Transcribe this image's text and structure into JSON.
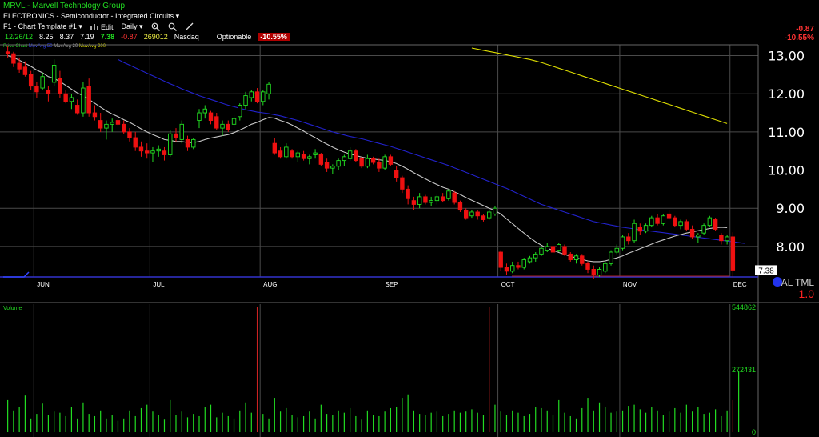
{
  "header": {
    "title": "MRVL - Marvell Technology Group",
    "sector": "ELECTRONICS - Semiconductor - Integrated Circuits",
    "sector_caret": "▾"
  },
  "toolbar": {
    "template": "F1 - Chart Template #1",
    "template_caret": "▾",
    "edit_label": "Edit",
    "period_label": "Daily",
    "period_caret": "▾"
  },
  "quote": {
    "date": "12/26/12",
    "open": "8.25",
    "high": "8.37",
    "low": "7.19",
    "close": "7.38",
    "change": "-0.87",
    "volume": "269012",
    "exchange": "Nasdaq",
    "options": "Optionable",
    "change_pct": "-10.55%"
  },
  "right_change": {
    "abs": "-0.87",
    "pct": "-10.55%"
  },
  "legend": {
    "price": "Price Chart",
    "ma50": "MovAvg 50",
    "ma20": "MovAvg 20",
    "ma200": "MovAvg 200"
  },
  "colors": {
    "up": "#22dd22",
    "down": "#ee1111",
    "ma20": "#c8c8c8",
    "ma50": "#2222cc",
    "ma200": "#dddd00",
    "grid": "#4a4a4a",
    "volume": "#22dd22"
  },
  "last_price_tag": "7.38",
  "axis_right_label": "AL TML",
  "axis_right_value": "1.0",
  "volume_label": "Volume",
  "chart_data": [
    {
      "type": "candlestick",
      "ylim": [
        7.2,
        13.2
      ],
      "yticks": [
        "13.00",
        "12.00",
        "11.00",
        "10.00",
        "9.00",
        "8.00"
      ],
      "months": [
        "JUN",
        "JUL",
        "AUG",
        "SEP",
        "OCT",
        "NOV",
        "DEC"
      ],
      "month_starts": [
        5,
        25,
        44,
        65,
        85,
        106,
        125
      ],
      "ohlc": [
        [
          13.1,
          13.25,
          12.95,
          13.05
        ],
        [
          13.05,
          13.1,
          12.7,
          12.8
        ],
        [
          12.8,
          12.95,
          12.55,
          12.65
        ],
        [
          12.7,
          12.85,
          12.45,
          12.5
        ],
        [
          12.5,
          12.6,
          12.1,
          12.2
        ],
        [
          12.2,
          12.3,
          11.9,
          12.05
        ],
        [
          12.15,
          12.55,
          12.1,
          12.45
        ],
        [
          12.1,
          12.2,
          11.8,
          12.0
        ],
        [
          12.3,
          12.9,
          12.2,
          12.75
        ],
        [
          12.4,
          12.6,
          11.9,
          12.0
        ],
        [
          12.0,
          12.1,
          11.75,
          11.8
        ],
        [
          11.8,
          12.0,
          11.6,
          11.9
        ],
        [
          11.7,
          11.85,
          11.45,
          11.5
        ],
        [
          11.5,
          12.3,
          11.4,
          12.15
        ],
        [
          12.2,
          12.4,
          11.4,
          11.5
        ],
        [
          11.5,
          11.7,
          11.3,
          11.4
        ],
        [
          11.3,
          11.5,
          11.0,
          11.1
        ],
        [
          11.1,
          11.3,
          10.8,
          11.2
        ],
        [
          11.2,
          11.35,
          11.0,
          11.25
        ],
        [
          11.3,
          11.4,
          11.15,
          11.2
        ],
        [
          11.2,
          11.3,
          10.95,
          11.0
        ],
        [
          11.0,
          11.1,
          10.75,
          10.85
        ],
        [
          10.85,
          11.0,
          10.5,
          10.6
        ],
        [
          10.6,
          10.75,
          10.35,
          10.5
        ],
        [
          10.5,
          10.7,
          10.3,
          10.45
        ],
        [
          10.45,
          10.6,
          10.2,
          10.5
        ],
        [
          10.5,
          10.65,
          10.35,
          10.55
        ],
        [
          10.5,
          10.6,
          10.25,
          10.4
        ],
        [
          10.4,
          11.05,
          10.35,
          10.95
        ],
        [
          10.95,
          11.1,
          10.75,
          10.85
        ],
        [
          10.8,
          11.3,
          10.7,
          11.2
        ],
        [
          10.8,
          10.9,
          10.5,
          10.6
        ],
        [
          10.6,
          10.85,
          10.55,
          10.8
        ],
        [
          11.3,
          11.6,
          11.1,
          11.5
        ],
        [
          11.5,
          11.7,
          11.35,
          11.6
        ],
        [
          11.5,
          11.55,
          11.2,
          11.3
        ],
        [
          11.4,
          11.5,
          11.05,
          11.1
        ],
        [
          11.1,
          11.3,
          10.9,
          11.2
        ],
        [
          11.2,
          11.3,
          11.0,
          11.05
        ],
        [
          11.2,
          11.45,
          11.1,
          11.35
        ],
        [
          11.4,
          11.75,
          11.3,
          11.7
        ],
        [
          11.7,
          12.05,
          11.6,
          11.95
        ],
        [
          11.9,
          12.1,
          11.8,
          12.05
        ],
        [
          12.05,
          12.15,
          11.75,
          11.8
        ],
        [
          11.8,
          12.1,
          11.7,
          12.05
        ],
        [
          12.0,
          12.3,
          11.85,
          12.25
        ],
        [
          10.7,
          10.85,
          10.4,
          10.45
        ],
        [
          10.5,
          10.6,
          10.3,
          10.35
        ],
        [
          10.35,
          10.7,
          10.3,
          10.6
        ],
        [
          10.5,
          10.55,
          10.3,
          10.35
        ],
        [
          10.35,
          10.5,
          10.2,
          10.45
        ],
        [
          10.4,
          10.5,
          10.25,
          10.3
        ],
        [
          10.3,
          10.4,
          10.15,
          10.35
        ],
        [
          10.4,
          10.55,
          10.3,
          10.45
        ],
        [
          10.4,
          10.45,
          10.1,
          10.15
        ],
        [
          10.2,
          10.3,
          9.95,
          10.05
        ],
        [
          10.05,
          10.15,
          9.9,
          10.1
        ],
        [
          10.1,
          10.3,
          10.0,
          10.25
        ],
        [
          10.25,
          10.4,
          10.1,
          10.35
        ],
        [
          10.3,
          10.6,
          10.25,
          10.5
        ],
        [
          10.5,
          10.55,
          10.2,
          10.25
        ],
        [
          10.3,
          10.35,
          10.05,
          10.1
        ],
        [
          10.1,
          10.4,
          10.05,
          10.3
        ],
        [
          10.3,
          10.35,
          10.15,
          10.2
        ],
        [
          10.2,
          10.3,
          9.95,
          10.05
        ],
        [
          10.05,
          10.4,
          10.0,
          10.35
        ],
        [
          10.35,
          10.4,
          10.1,
          10.15
        ],
        [
          10.0,
          10.1,
          9.7,
          9.8
        ],
        [
          9.8,
          9.85,
          9.4,
          9.5
        ],
        [
          9.5,
          9.6,
          9.1,
          9.25
        ],
        [
          9.2,
          9.3,
          8.95,
          9.1
        ],
        [
          9.1,
          9.4,
          9.0,
          9.3
        ],
        [
          9.3,
          9.35,
          9.1,
          9.15
        ],
        [
          9.15,
          9.3,
          9.05,
          9.2
        ],
        [
          9.2,
          9.35,
          9.1,
          9.3
        ],
        [
          9.3,
          9.4,
          9.15,
          9.2
        ],
        [
          9.25,
          9.5,
          9.2,
          9.45
        ],
        [
          9.4,
          9.45,
          9.1,
          9.15
        ],
        [
          9.15,
          9.2,
          8.9,
          8.95
        ],
        [
          8.95,
          9.0,
          8.7,
          8.75
        ],
        [
          8.8,
          8.95,
          8.75,
          8.9
        ],
        [
          8.9,
          8.95,
          8.7,
          8.8
        ],
        [
          8.8,
          8.85,
          8.65,
          8.7
        ],
        [
          8.75,
          8.95,
          8.7,
          8.9
        ],
        [
          8.85,
          9.05,
          8.8,
          9.0
        ],
        [
          7.85,
          7.9,
          7.35,
          7.45
        ],
        [
          7.45,
          7.55,
          7.25,
          7.35
        ],
        [
          7.35,
          7.6,
          7.3,
          7.5
        ],
        [
          7.5,
          7.6,
          7.4,
          7.45
        ],
        [
          7.45,
          7.7,
          7.4,
          7.65
        ],
        [
          7.6,
          7.75,
          7.55,
          7.7
        ],
        [
          7.7,
          7.85,
          7.6,
          7.8
        ],
        [
          7.8,
          8.0,
          7.75,
          7.95
        ],
        [
          7.9,
          8.1,
          7.85,
          8.0
        ],
        [
          8.0,
          8.05,
          7.8,
          7.85
        ],
        [
          7.9,
          8.1,
          7.85,
          8.05
        ],
        [
          8.0,
          8.05,
          7.75,
          7.8
        ],
        [
          7.8,
          7.85,
          7.6,
          7.65
        ],
        [
          7.65,
          7.8,
          7.55,
          7.75
        ],
        [
          7.75,
          7.8,
          7.5,
          7.55
        ],
        [
          7.55,
          7.6,
          7.3,
          7.4
        ],
        [
          7.4,
          7.5,
          7.15,
          7.25
        ],
        [
          7.25,
          7.45,
          7.2,
          7.4
        ],
        [
          7.35,
          7.6,
          7.3,
          7.55
        ],
        [
          7.55,
          7.9,
          7.5,
          7.85
        ],
        [
          7.85,
          8.05,
          7.8,
          7.95
        ],
        [
          7.95,
          8.3,
          7.9,
          8.25
        ],
        [
          8.25,
          8.35,
          8.05,
          8.15
        ],
        [
          8.15,
          8.7,
          8.1,
          8.6
        ],
        [
          8.5,
          8.6,
          8.3,
          8.4
        ],
        [
          8.4,
          8.6,
          8.35,
          8.55
        ],
        [
          8.55,
          8.8,
          8.5,
          8.75
        ],
        [
          8.75,
          8.85,
          8.55,
          8.6
        ],
        [
          8.6,
          8.85,
          8.55,
          8.8
        ],
        [
          8.85,
          8.95,
          8.7,
          8.75
        ],
        [
          8.75,
          8.8,
          8.5,
          8.55
        ],
        [
          8.55,
          8.7,
          8.45,
          8.65
        ],
        [
          8.65,
          8.7,
          8.4,
          8.45
        ],
        [
          8.45,
          8.55,
          8.2,
          8.25
        ],
        [
          8.25,
          8.35,
          8.1,
          8.3
        ],
        [
          8.35,
          8.6,
          8.3,
          8.55
        ],
        [
          8.55,
          8.8,
          8.5,
          8.75
        ],
        [
          8.7,
          8.75,
          8.4,
          8.45
        ],
        [
          8.3,
          8.35,
          8.05,
          8.15
        ],
        [
          8.15,
          8.3,
          8.05,
          8.25
        ],
        [
          8.25,
          8.37,
          7.19,
          7.38
        ]
      ],
      "ma20": [
        13.0,
        12.95,
        12.88,
        12.8,
        12.72,
        12.62,
        12.55,
        12.45,
        12.4,
        12.32,
        12.22,
        12.12,
        12.02,
        11.95,
        11.85,
        11.75,
        11.65,
        11.55,
        11.47,
        11.4,
        11.32,
        11.25,
        11.17,
        11.08,
        11.0,
        10.93,
        10.87,
        10.8,
        10.78,
        10.75,
        10.75,
        10.72,
        10.72,
        10.75,
        10.8,
        10.84,
        10.87,
        10.9,
        10.93,
        10.98,
        11.05,
        11.12,
        11.2,
        11.25,
        11.32,
        11.38,
        11.36,
        11.3,
        11.25,
        11.18,
        11.1,
        11.02,
        10.93,
        10.85,
        10.76,
        10.68,
        10.6,
        10.53,
        10.47,
        10.42,
        10.38,
        10.34,
        10.31,
        10.29,
        10.27,
        10.25,
        10.22,
        10.17,
        10.1,
        10.02,
        9.93,
        9.85,
        9.77,
        9.69,
        9.62,
        9.55,
        9.5,
        9.43,
        9.36,
        9.28,
        9.21,
        9.14,
        9.07,
        9.0,
        8.94,
        8.85,
        8.72,
        8.6,
        8.47,
        8.35,
        8.23,
        8.12,
        8.03,
        7.95,
        7.9,
        7.84,
        7.79,
        7.74,
        7.7,
        7.66,
        7.62,
        7.6,
        7.6,
        7.62,
        7.66,
        7.7,
        7.75,
        7.82,
        7.88,
        7.94,
        8.0,
        8.06,
        8.12,
        8.17,
        8.22,
        8.27,
        8.31,
        8.35,
        8.38,
        8.41,
        8.44,
        8.47,
        8.49,
        8.5,
        8.49
      ],
      "ma50": [
        null,
        null,
        null,
        null,
        null,
        null,
        null,
        null,
        null,
        null,
        null,
        null,
        null,
        null,
        null,
        null,
        null,
        null,
        null,
        12.9,
        12.82,
        12.75,
        12.68,
        12.61,
        12.54,
        12.47,
        12.4,
        12.33,
        12.26,
        12.2,
        12.13,
        12.07,
        12.01,
        11.95,
        11.9,
        11.85,
        11.8,
        11.75,
        11.7,
        11.66,
        11.62,
        11.58,
        11.55,
        11.52,
        11.5,
        11.48,
        11.45,
        11.42,
        11.38,
        11.34,
        11.3,
        11.25,
        11.2,
        11.15,
        11.1,
        11.05,
        11.0,
        10.96,
        10.92,
        10.88,
        10.85,
        10.82,
        10.78,
        10.74,
        10.7,
        10.66,
        10.62,
        10.57,
        10.52,
        10.47,
        10.42,
        10.37,
        10.32,
        10.27,
        10.22,
        10.17,
        10.12,
        10.06,
        10.0,
        9.94,
        9.88,
        9.82,
        9.76,
        9.7,
        9.64,
        9.58,
        9.52,
        9.45,
        9.38,
        9.31,
        9.24,
        9.17,
        9.1,
        9.05,
        9.0,
        8.95,
        8.9,
        8.85,
        8.8,
        8.75,
        8.7,
        8.65,
        8.62,
        8.59,
        8.56,
        8.53,
        8.5,
        8.48,
        8.46,
        8.44,
        8.42,
        8.4,
        8.38,
        8.36,
        8.34,
        8.32,
        8.3,
        8.28,
        8.26,
        8.24,
        8.22,
        8.2,
        8.18,
        8.16,
        8.14,
        8.12,
        8.1,
        8.08
      ],
      "ma200": [
        null,
        null,
        null,
        null,
        null,
        null,
        null,
        null,
        null,
        null,
        null,
        null,
        null,
        null,
        null,
        null,
        null,
        null,
        null,
        null,
        null,
        null,
        null,
        null,
        null,
        null,
        null,
        null,
        null,
        null,
        null,
        null,
        null,
        null,
        null,
        null,
        null,
        null,
        null,
        null,
        null,
        null,
        null,
        null,
        null,
        null,
        null,
        null,
        null,
        null,
        null,
        null,
        null,
        null,
        null,
        null,
        null,
        null,
        null,
        null,
        null,
        null,
        null,
        null,
        null,
        null,
        null,
        null,
        null,
        null,
        null,
        null,
        null,
        null,
        null,
        null,
        null,
        null,
        null,
        null,
        13.2,
        13.17,
        13.14,
        13.11,
        13.08,
        13.05,
        13.02,
        12.99,
        12.96,
        12.93,
        12.9,
        12.86,
        12.82,
        12.77,
        12.72,
        12.67,
        12.62,
        12.57,
        12.52,
        12.47,
        12.42,
        12.37,
        12.32,
        12.27,
        12.22,
        12.17,
        12.12,
        12.07,
        12.02,
        11.97,
        11.92,
        11.87,
        11.82,
        11.77,
        11.72,
        11.67,
        11.62,
        11.57,
        11.52,
        11.47,
        11.42,
        11.37,
        11.32,
        11.27,
        11.22,
        null,
        null,
        null
      ],
      "volume_ylim": [
        0,
        544862
      ],
      "volume_ticks": [
        "544862",
        "272431",
        "0"
      ],
      "volume": [
        140000,
        95000,
        110000,
        160000,
        60000,
        80000,
        125000,
        75000,
        90000,
        85000,
        70000,
        110000,
        60000,
        130000,
        80000,
        70000,
        95000,
        60000,
        75000,
        50000,
        60000,
        95000,
        70000,
        105000,
        120000,
        90000,
        75000,
        55000,
        140000,
        75000,
        90000,
        65000,
        80000,
        70000,
        110000,
        120000,
        65000,
        85000,
        70000,
        60000,
        95000,
        130000,
        85000,
        544862,
        80000,
        60000,
        150000,
        90000,
        105000,
        75000,
        65000,
        70000,
        90000,
        60000,
        120000,
        80000,
        75000,
        95000,
        85000,
        105000,
        70000,
        55000,
        95000,
        75000,
        70000,
        90000,
        105000,
        110000,
        150000,
        165000,
        95000,
        80000,
        75000,
        85000,
        90000,
        70000,
        80000,
        95000,
        85000,
        90000,
        100000,
        85000,
        75000,
        544862,
        120000,
        90000,
        75000,
        95000,
        85000,
        70000,
        80000,
        110000,
        105000,
        95000,
        75000,
        140000,
        85000,
        70000,
        60000,
        105000,
        150000,
        95000,
        130000,
        110000,
        85000,
        90000,
        95000,
        115000,
        120000,
        100000,
        85000,
        110000,
        95000,
        75000,
        90000,
        105000,
        85000,
        120000,
        90000,
        110000,
        80000,
        85000,
        100000,
        70000,
        95000,
        140000,
        269012
      ]
    }
  ]
}
